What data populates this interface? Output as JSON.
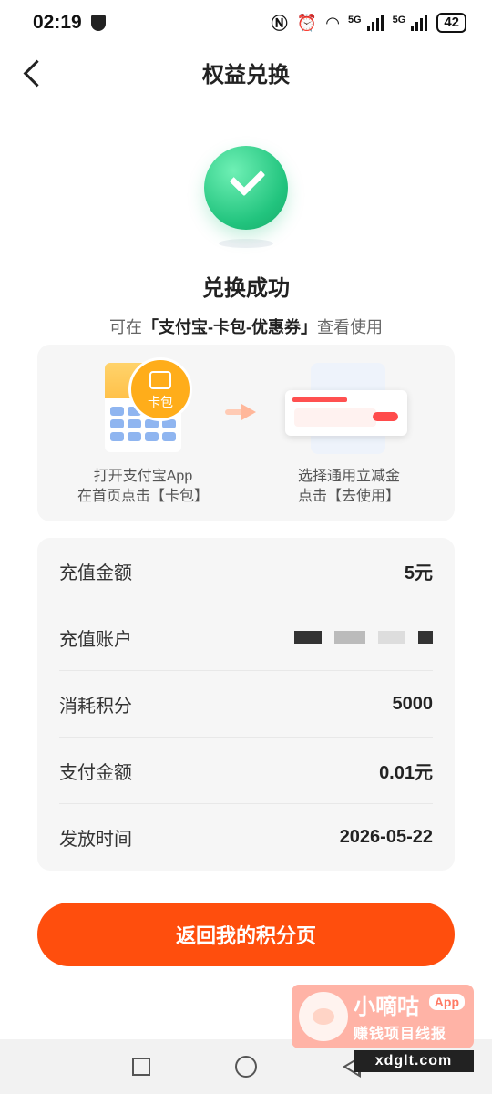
{
  "status_bar": {
    "time": "02:19",
    "network_1": "5G",
    "network_2": "5G",
    "battery": "42",
    "icons": [
      "shield-icon",
      "nfc-icon",
      "alarm-icon",
      "wifi-icon",
      "signal-icon",
      "battery-icon"
    ]
  },
  "nav": {
    "title": "权益兑换",
    "back_icon": "chevron-left-icon"
  },
  "success": {
    "icon": "check-circle-icon",
    "color": "#22c47e",
    "title": "兑换成功",
    "sub_prefix": "可在",
    "sub_highlight": "「支付宝-卡包-优惠券」",
    "sub_suffix": "查看使用"
  },
  "guide": {
    "step1_badge": "卡包",
    "step1_line1": "打开支付宝App",
    "step1_line2": "在首页点击【卡包】",
    "step2_line1": "选择通用立减金",
    "step2_line2": "点击【去使用】"
  },
  "details": {
    "rows": [
      {
        "label": "充值金额",
        "value": "5元"
      },
      {
        "label": "充值账户",
        "value": ""
      },
      {
        "label": "消耗积分",
        "value": "5000"
      },
      {
        "label": "支付金额",
        "value": "0.01元"
      },
      {
        "label": "发放时间",
        "value": "2026-05-22"
      }
    ]
  },
  "return_button": {
    "label": "返回我的积分页",
    "color": "#ff4e0d"
  },
  "watermark": {
    "title": "小嘀咕",
    "badge": "App",
    "subtitle": "赚钱项目线报",
    "url": "xdglt.com"
  }
}
